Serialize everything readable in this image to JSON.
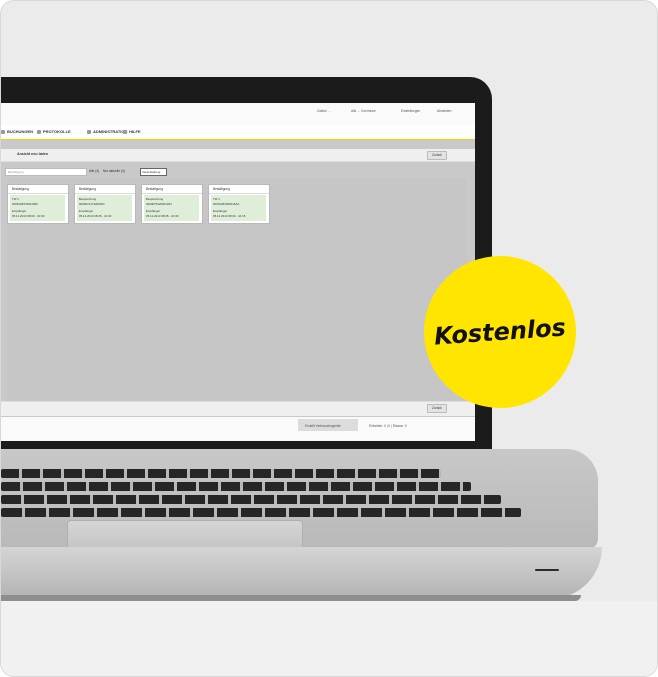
{
  "badge": {
    "text": "Kostenlos",
    "color": "#ffe500"
  },
  "app": {
    "header": {
      "items": [
        "Zuletzt …",
        "Alle … Kommune",
        "Einstellungen",
        "Abmelden"
      ]
    },
    "nav": {
      "tabs": [
        {
          "label": "BUCHUNGEN",
          "icon": "calendar-icon"
        },
        {
          "label": "PROTOKOLLE",
          "icon": "document-icon"
        },
        {
          "label": "ADMINISTRATION",
          "icon": "users-icon"
        },
        {
          "label": "HILFE",
          "icon": "help-icon"
        }
      ]
    },
    "toolbar": {
      "reload_label": "Ansicht neu laden",
      "back_label": "Zurück"
    },
    "filter": {
      "search_placeholder": "Bestätigung",
      "count_label": "Alle (4)",
      "current_label": "Nur aktuelle (4)",
      "sort_value": "Veranstaltung"
    },
    "cards": [
      {
        "title": "Bestätigung",
        "line1": "TW 1",
        "line2": "0000128379001900",
        "line3": "Empfänger",
        "line4": "05.12.2013 08:00 - 10:00"
      },
      {
        "title": "Bestätigung",
        "line1": "Besprechung",
        "line2": "0000074174200201",
        "line3": "Empfänger",
        "line4": "05.12.2013 08:45 - 10:30"
      },
      {
        "title": "Bestätigung",
        "line1": "Besprechung",
        "line2": "0000075420001034",
        "line3": "Empfänger",
        "line4": "05.12.2013 08:45 - 10:30"
      },
      {
        "title": "Bestätigung",
        "line1": "TW 1",
        "line2": "0000128400001FAA",
        "line3": "Empfänger",
        "line4": "05.12.2013 08:30 - 10:15"
      }
    ],
    "bottom_back_label": "Zurück",
    "status": {
      "left": "Erstellt Verbrauchsgeräte",
      "right": "Einheiten: 0 | 0 | Räume: 0"
    }
  }
}
